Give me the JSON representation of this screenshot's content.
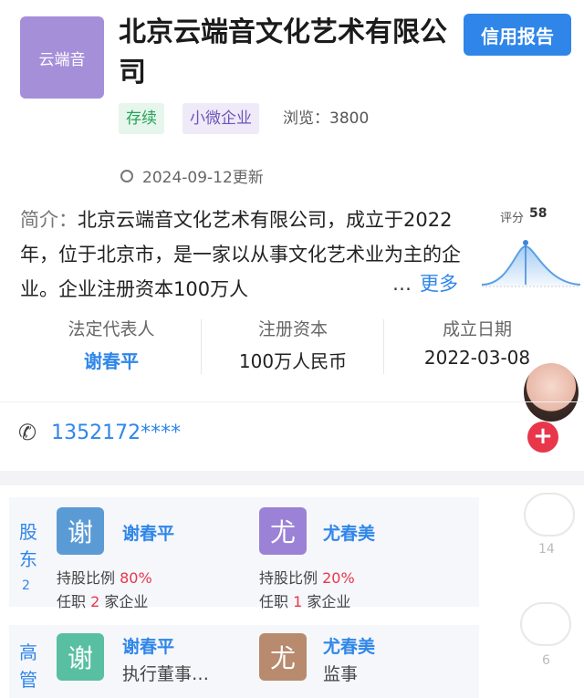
{
  "header": {
    "logo_text": "云端音",
    "company_name": "北京云端音文化艺术有限公司",
    "credit_report_label": "信用报告",
    "tags": [
      "存续",
      "小微企业"
    ],
    "views_label": "浏览：",
    "views_count": "3800",
    "update_text": "2024-09-12更新"
  },
  "intro": {
    "label": "简介：",
    "text": "北京云端音文化艺术有限公司，成立于2022年，位于北京市，是一家以从事文化艺术业为主的企业。企业注册资本100万人",
    "ellipsis": "…",
    "more_label": "更多"
  },
  "score": {
    "label": "评分",
    "value": "58"
  },
  "key_info": {
    "legal_rep_label": "法定代表人",
    "legal_rep_value": "谢春平",
    "reg_capital_label": "注册资本",
    "reg_capital_value": "100万人民币",
    "founded_label": "成立日期",
    "founded_value": "2022-03-08"
  },
  "contact": {
    "phone": "1352172****"
  },
  "shareholders": {
    "label": "股东",
    "count": "2",
    "items": [
      {
        "avatar_char": "谢",
        "name": "谢春平",
        "ratio_label": "持股比例",
        "ratio": "80%",
        "jobs_prefix": "任职",
        "jobs_count": "2",
        "jobs_suffix": "家企业",
        "color": "#5b9bd5"
      },
      {
        "avatar_char": "尤",
        "name": "尤春美",
        "ratio_label": "持股比例",
        "ratio": "20%",
        "jobs_prefix": "任职",
        "jobs_count": "1",
        "jobs_suffix": "家企业",
        "color": "#9b82d6"
      }
    ]
  },
  "executives": {
    "label": "高管",
    "items": [
      {
        "avatar_char": "谢",
        "name": "谢春平",
        "role": "执行董事…",
        "color": "#59bfa2"
      },
      {
        "avatar_char": "尤",
        "name": "尤春美",
        "role": "监事",
        "color": "#b88a6e"
      }
    ]
  },
  "side": {
    "count_a": "14",
    "count_b": "6"
  },
  "colors": {
    "accent": "#2f86e8",
    "status_green": "#25a35a",
    "danger": "#e8364a"
  }
}
